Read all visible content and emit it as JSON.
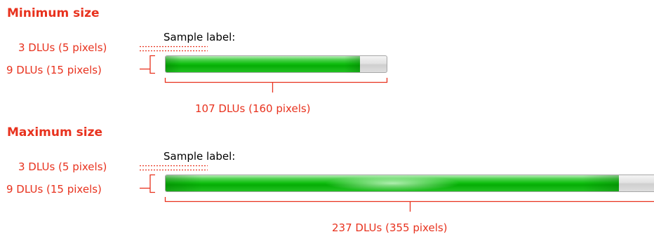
{
  "colors": {
    "annotation": "#e8321e",
    "progress_fill": "#06b406",
    "track": "#dcdcdc"
  },
  "sections": {
    "minimum": {
      "heading": "Minimum size",
      "sample_label": "Sample label:",
      "spacing_annotation": "3 DLUs (5 pixels)",
      "height_annotation": "9 DLUs (15 pixels)",
      "width_annotation": "107 DLUs (160 pixels)",
      "progress_fraction": 0.88
    },
    "maximum": {
      "heading": "Maximum size",
      "sample_label": "Sample label:",
      "spacing_annotation": "3 DLUs (5 pixels)",
      "height_annotation": "9 DLUs (15 pixels)",
      "width_annotation": "237 DLUs (355 pixels)",
      "progress_fraction": 0.91
    }
  }
}
